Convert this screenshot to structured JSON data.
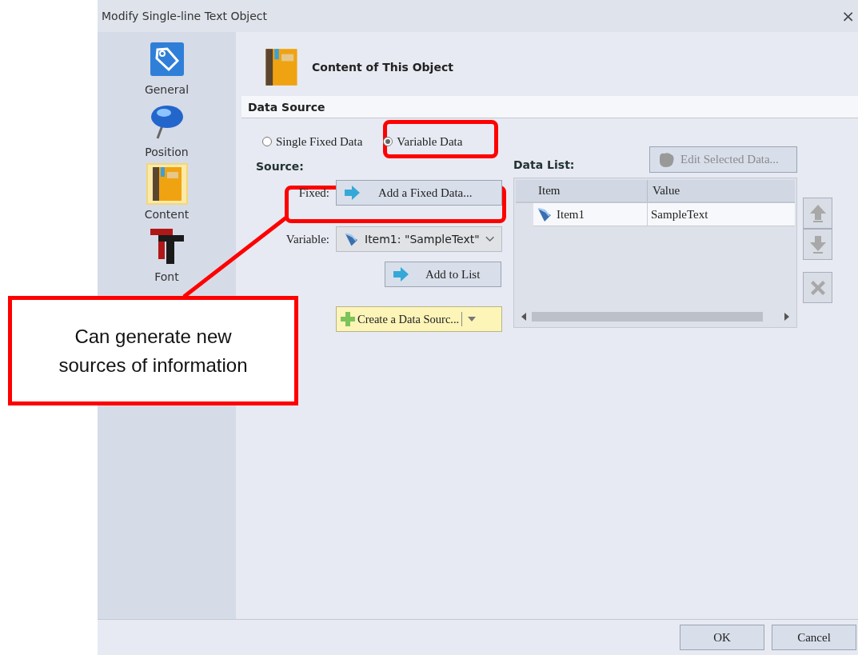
{
  "window": {
    "title": "Modify Single-line Text Object",
    "close": "×"
  },
  "sidebar": {
    "items": [
      {
        "label": "General",
        "kind": "tag",
        "selected": false
      },
      {
        "label": "Position",
        "kind": "pin",
        "selected": false
      },
      {
        "label": "Content",
        "kind": "book",
        "selected": true
      },
      {
        "label": "Font",
        "kind": "font",
        "selected": false
      }
    ]
  },
  "header": {
    "title": "Content of This Object"
  },
  "data_source": {
    "title": "Data Source",
    "options": [
      {
        "label": "Single Fixed Data",
        "selected": false
      },
      {
        "label": "Variable Data",
        "selected": true
      }
    ]
  },
  "source": {
    "title": "Source:",
    "fixed_label": "Fixed:",
    "fixed_button": "Add a Fixed Data...",
    "variable_label": "Variable:",
    "variable_value": "Item1: \"SampleText\"",
    "add_button": "Add to List",
    "create_button": "Create a Data Sourc..."
  },
  "data_list": {
    "title": "Data List:",
    "edit_button": {
      "label": "Edit Selected Data...",
      "disabled": true
    },
    "columns": [
      "Item",
      "Value"
    ],
    "rows": [
      {
        "item": "Item1",
        "value": "SampleText"
      }
    ]
  },
  "buttons": [
    {
      "label": "OK"
    },
    {
      "label": "Cancel"
    }
  ],
  "callout": {
    "text": "Can generate new sources of information"
  }
}
